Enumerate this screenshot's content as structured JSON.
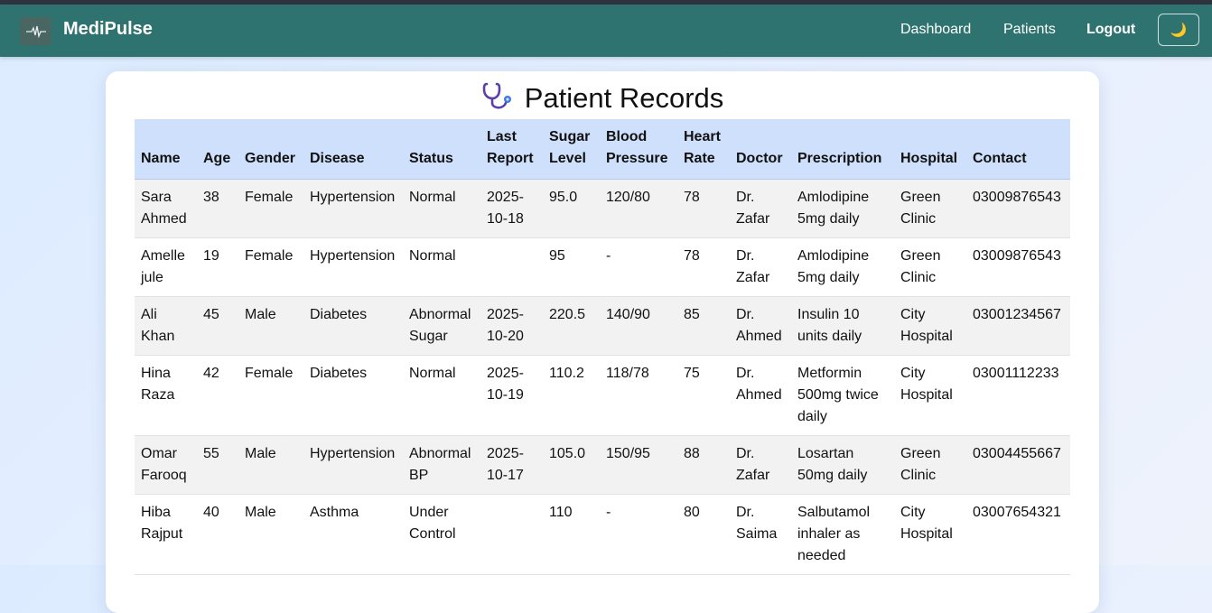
{
  "app": {
    "brand": "MediPulse",
    "logo_icon": "heartbeat-icon",
    "nav": {
      "dashboard": "Dashboard",
      "patients": "Patients",
      "logout": "Logout"
    },
    "theme_toggle": {
      "icon": "moon-icon",
      "glyph": "🌙"
    },
    "colors": {
      "navbar": "#2f7370",
      "table_header": "#cfe0fc"
    }
  },
  "page": {
    "title": "Patient Records",
    "title_icon": "stethoscope-icon"
  },
  "table": {
    "headers": [
      "Name",
      "Age",
      "Gender",
      "Disease",
      "Status",
      "Last Report",
      "Sugar Level",
      "Blood Pressure",
      "Heart Rate",
      "Doctor",
      "Prescription",
      "Hospital",
      "Contact"
    ],
    "rows": [
      [
        "Sara Ahmed",
        "38",
        "Female",
        "Hypertension",
        "Normal",
        "2025-10-18",
        "95.0",
        "120/80",
        "78",
        "Dr. Zafar",
        "Amlodipine 5mg daily",
        "Green Clinic",
        "03009876543"
      ],
      [
        "Amelle jule",
        "19",
        "Female",
        "Hypertension",
        "Normal",
        "",
        "95",
        "-",
        "78",
        "Dr. Zafar",
        "Amlodipine 5mg daily",
        "Green Clinic",
        "03009876543"
      ],
      [
        "Ali Khan",
        "45",
        "Male",
        "Diabetes",
        "Abnormal Sugar",
        "2025-10-20",
        "220.5",
        "140/90",
        "85",
        "Dr. Ahmed",
        "Insulin 10 units daily",
        "City Hospital",
        "03001234567"
      ],
      [
        "Hina Raza",
        "42",
        "Female",
        "Diabetes",
        "Normal",
        "2025-10-19",
        "110.2",
        "118/78",
        "75",
        "Dr. Ahmed",
        "Metformin 500mg twice daily",
        "City Hospital",
        "03001112233"
      ],
      [
        "Omar Farooq",
        "55",
        "Male",
        "Hypertension",
        "Abnormal BP",
        "2025-10-17",
        "105.0",
        "150/95",
        "88",
        "Dr. Zafar",
        "Losartan 50mg daily",
        "Green Clinic",
        "03004455667"
      ],
      [
        "Hiba Rajput",
        "40",
        "Male",
        "Asthma",
        "Under Control",
        "",
        "110",
        "-",
        "80",
        "Dr. Saima",
        "Salbutamol inhaler as needed",
        "City Hospital",
        "03007654321"
      ]
    ]
  }
}
